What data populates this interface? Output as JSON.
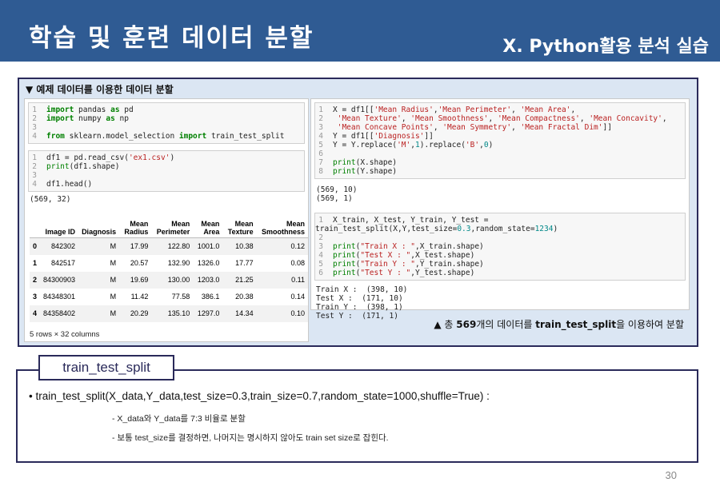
{
  "header": {
    "title": "학습 및 훈련 데이터 분할",
    "subtitle": "X. Python활용 분석 실습",
    "background": "#2f5b93"
  },
  "example": {
    "heading": "▼ 예제 데이터를 이용한 데이터 분할",
    "left": {
      "cell1": [
        "import pandas as pd",
        "import numpy as np",
        "",
        "from sklearn.model_selection import train_test_split"
      ],
      "cell2": [
        "df1 = pd.read_csv('ex1.csv')",
        "print(df1.shape)",
        "",
        "df1.head()"
      ],
      "output_shape": "(569, 32)",
      "table": {
        "columns": [
          "",
          "Image ID",
          "Diagnosis",
          "Mean Radius",
          "Mean Perimeter",
          "Mean Area",
          "Mean Texture",
          "Mean Smoothness"
        ],
        "rows": [
          [
            "0",
            "842302",
            "M",
            "17.99",
            "122.80",
            "1001.0",
            "10.38",
            "0.12"
          ],
          [
            "1",
            "842517",
            "M",
            "20.57",
            "132.90",
            "1326.0",
            "17.77",
            "0.08"
          ],
          [
            "2",
            "84300903",
            "M",
            "19.69",
            "130.00",
            "1203.0",
            "21.25",
            "0.11"
          ],
          [
            "3",
            "84348301",
            "M",
            "11.42",
            "77.58",
            "386.1",
            "20.38",
            "0.14"
          ],
          [
            "4",
            "84358402",
            "M",
            "20.29",
            "135.10",
            "1297.0",
            "14.34",
            "0.10"
          ]
        ],
        "footer": "5 rows × 32 columns"
      }
    },
    "right": {
      "cell1": [
        "X = df1[['Mean Radius','Mean Perimeter', 'Mean Area',",
        "        'Mean Texture', 'Mean Smoothness', 'Mean Compactness', 'Mean Concavity',",
        "        'Mean Concave Points', 'Mean Symmetry', 'Mean Fractal Dim']]",
        "Y = df1[['Diagnosis']]",
        "Y = Y.replace('M',1).replace('B',0)",
        "",
        "print(X.shape)",
        "print(Y.shape)"
      ],
      "output1": "(569, 10)\n(569, 1)",
      "cell2": [
        "X_train, X_test, Y_train, Y_test = train_test_split(X,Y,test_size=0.3,random_state=1234)",
        "",
        "print(\"Train X : \",X_train.shape)",
        "print(\"Test X : \",X_test.shape)",
        "print(\"Train Y : \",Y_train.shape)",
        "print(\"Test Y : \",Y_test.shape)"
      ],
      "output2": "Train X :  (398, 10)\nTest X :  (171, 10)\nTrain Y :  (398, 1)\nTest Y :  (171, 1)",
      "caption_prefix": "▲ 총 ",
      "caption_bold1": "569",
      "caption_mid": "개의 데이터를 ",
      "caption_bold2": "train_test_split",
      "caption_suffix": "을 이용하여 분할"
    }
  },
  "tts": {
    "label": "train_test_split",
    "signature": "• train_test_split(X_data,Y_data,test_size=0.3,train_size=0.7,random_state=1000,shuffle=True) :",
    "note1": "- X_data와 Y_data를 7:3 비율로 분할",
    "note2": "- 보통 test_size를 결정하면, 나머지는 명시하지 않아도 train set size로 잡힌다."
  },
  "page_number": "30"
}
